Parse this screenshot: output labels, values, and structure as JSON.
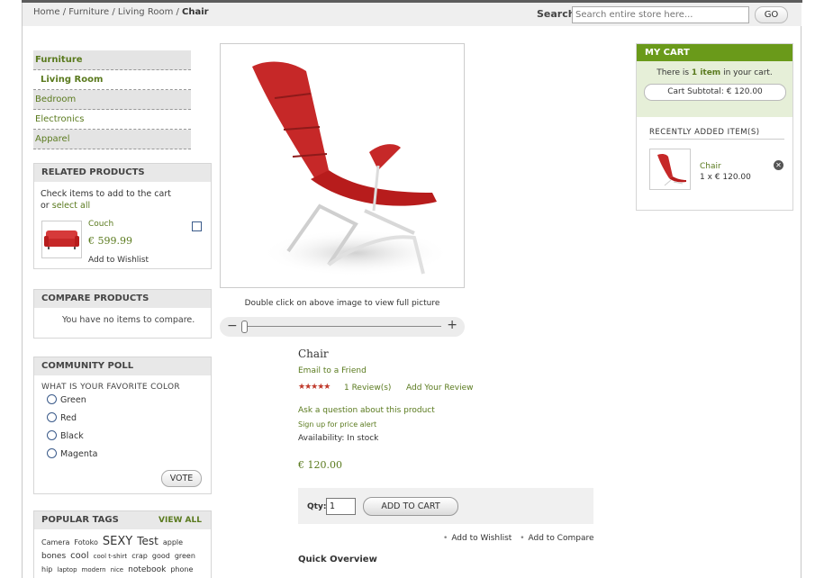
{
  "breadcrumb": {
    "home": "Home /",
    "furniture": "Furniture /",
    "living_room": "Living Room /",
    "current": "Chair"
  },
  "search": {
    "label": "Search",
    "placeholder": "Search entire store here...",
    "button": "GO"
  },
  "categories": [
    "Furniture",
    "Living Room",
    "Bedroom",
    "Electronics",
    "Apparel"
  ],
  "related": {
    "title": "RELATED PRODUCTS",
    "intro_line1": "Check items to add to the cart",
    "intro_prefix": "or",
    "select_all": "select all",
    "item": {
      "name": "Couch",
      "price": "€ 599.99",
      "wishlist": "Add to Wishlist"
    }
  },
  "compare": {
    "title": "COMPARE PRODUCTS",
    "message": "You have no items to compare."
  },
  "poll": {
    "title": "COMMUNITY POLL",
    "question": "WHAT IS YOUR FAVORITE COLOR",
    "options": [
      "Green",
      "Red",
      "Black",
      "Magenta"
    ],
    "vote": "VOTE"
  },
  "tags": {
    "title": "POPULAR TAGS",
    "view_all": "VIEW ALL",
    "line1": [
      {
        "t": "Camera",
        "s": 8
      },
      {
        "t": "Fotoko",
        "s": 8
      },
      {
        "t": "SEXY",
        "s": 13
      },
      {
        "t": "Test",
        "s": 12
      },
      {
        "t": "apple",
        "s": 8
      }
    ],
    "line2": [
      {
        "t": "bones",
        "s": 9
      },
      {
        "t": "cool",
        "s": 10
      },
      {
        "t": "cool t-shirt",
        "s": 7
      },
      {
        "t": "crap",
        "s": 8
      },
      {
        "t": "good",
        "s": 8
      },
      {
        "t": "green",
        "s": 8
      }
    ],
    "line3": [
      {
        "t": "hip",
        "s": 8
      },
      {
        "t": "laptop",
        "s": 7
      },
      {
        "t": "modern",
        "s": 7
      },
      {
        "t": "nice",
        "s": 7
      },
      {
        "t": "notebook",
        "s": 9
      },
      {
        "t": "phone",
        "s": 8
      }
    ]
  },
  "product": {
    "image_caption": "Double click on above image to view full picture",
    "name": "Chair",
    "email_friend": "Email to a Friend",
    "rating_stars": "★★★★★",
    "reviews": "1 Review(s)",
    "add_review": "Add Your Review",
    "ask_question": "Ask a question about this product",
    "price_alert": "Sign up for price alert",
    "availability": "Availability: In stock",
    "price": "€ 120.00",
    "qty_label": "Qty:",
    "qty_value": "1",
    "add_to_cart": "ADD TO CART",
    "add_to_wishlist": "Add to Wishlist",
    "add_to_compare": "Add to Compare",
    "quick_overview": "Quick Overview"
  },
  "cart": {
    "title": "MY CART",
    "there_is": "There is",
    "items_count": "1 item",
    "in_cart": "in your cart.",
    "subtotal": "Cart Subtotal: € 120.00",
    "recently_added": "RECENTLY ADDED ITEM(S)",
    "item_name": "Chair",
    "item_qty": "1 x € 120.00"
  },
  "colors": {
    "accent_green": "#6a9a1a",
    "link_green": "#5a7a1e",
    "product_red": "#c62828"
  }
}
